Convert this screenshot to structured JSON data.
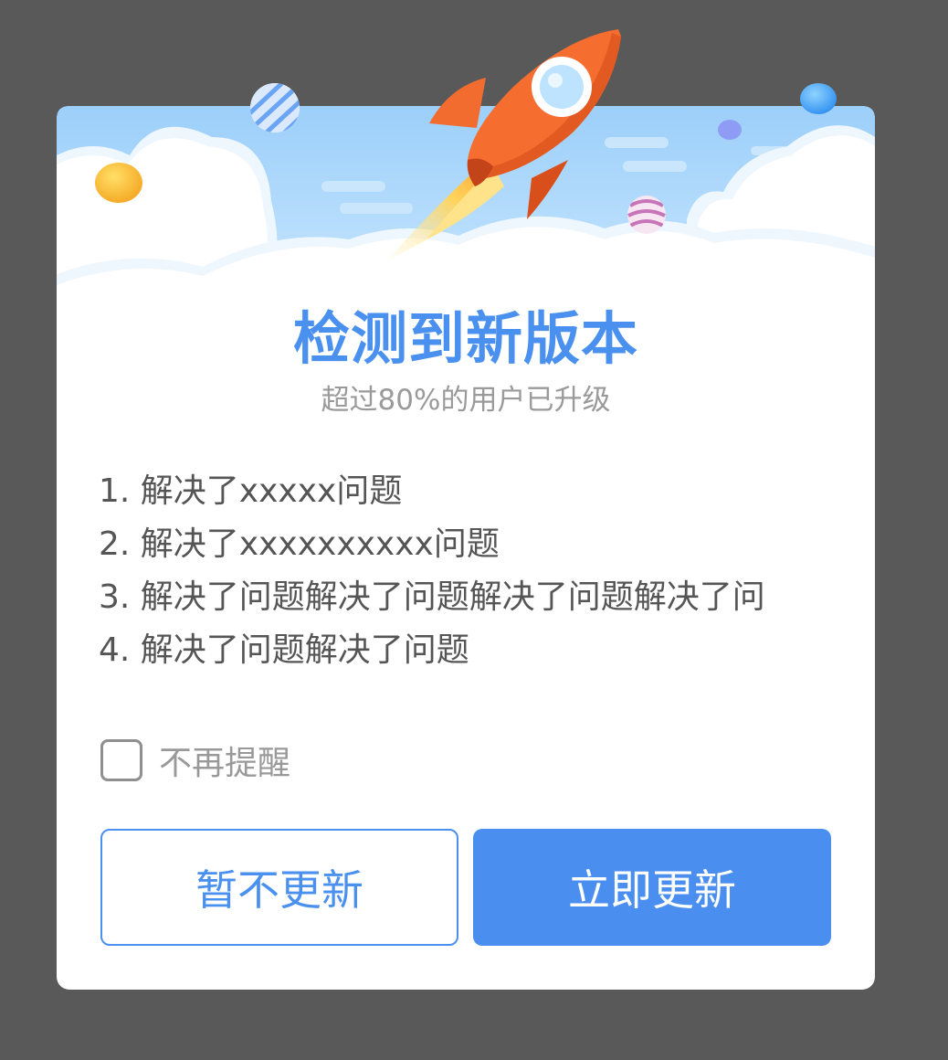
{
  "dialog": {
    "title": "检测到新版本",
    "subtitle": "超过80%的用户已升级",
    "notes": [
      "1. 解决了xxxxx问题",
      "2. 解决了xxxxxxxxxx问题",
      "3. 解决了问题解决了问题解决了问题解决了问",
      "4. 解决了问题解决了问题"
    ],
    "remind_checkbox": {
      "label": "不再提醒",
      "checked": false
    },
    "buttons": {
      "later": "暂不更新",
      "update_now": "立即更新"
    }
  },
  "header_art": {
    "icons": [
      "rocket-icon",
      "cloud-icon",
      "planet-icon"
    ]
  },
  "colors": {
    "accent": "#4a90ef",
    "overlay": "#595959",
    "sky": "#a9d6fb",
    "rocket": "#f26a2e"
  }
}
